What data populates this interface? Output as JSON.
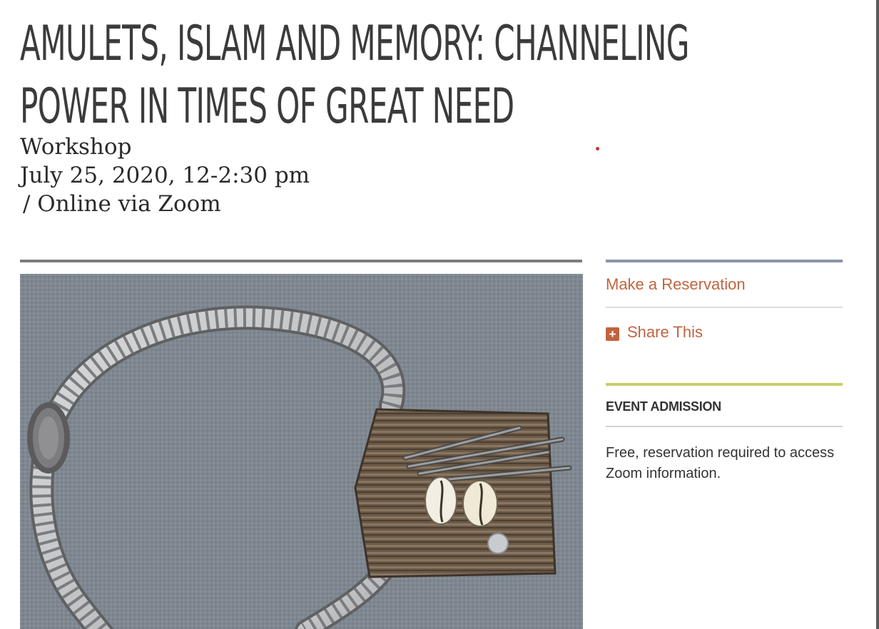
{
  "event": {
    "title_line1": "AMULETS, ISLAM AND MEMORY: CHANNELING",
    "title_line2": "POWER IN TIMES OF GREAT NEED",
    "type": "Workshop",
    "date_time": "July 25, 2020, 12-2:30 pm",
    "location": "/ Online via Zoom"
  },
  "hero_image": {
    "description": "amulet-with-rope-cowrie-shells"
  },
  "sidebar": {
    "reservation_label": "Make a Reservation",
    "share_label": "Share This",
    "share_icon": "plus-icon",
    "admission_heading": "EVENT ADMISSION",
    "admission_text": "Free, reservation required to access Zoom information."
  },
  "colors": {
    "link": "#c0643f",
    "top_rule": "#8d93a6",
    "admission_rule": "#c9ce6d",
    "text": "#333333"
  }
}
